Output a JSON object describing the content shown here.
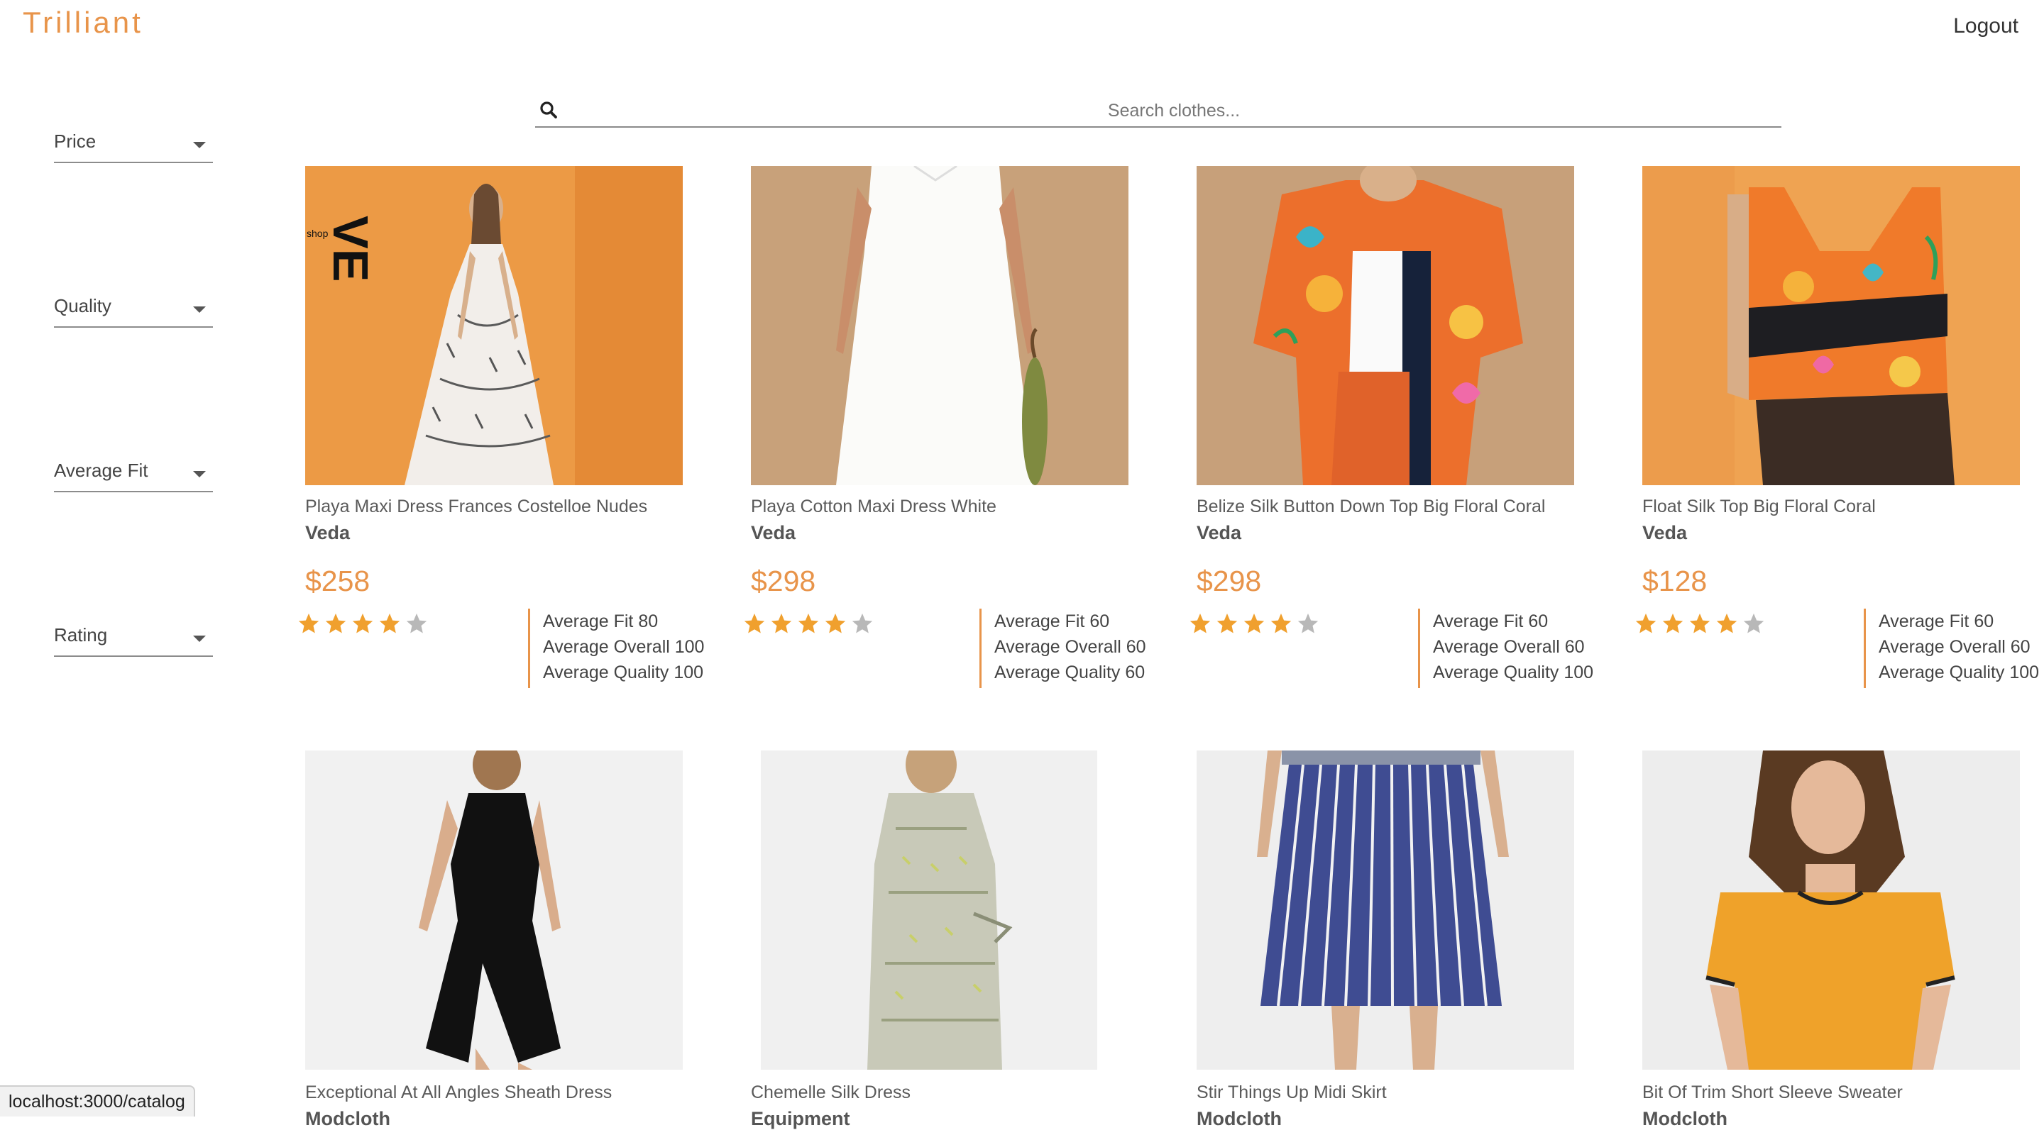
{
  "header": {
    "logo": "Trilliant",
    "logout": "Logout"
  },
  "search": {
    "placeholder": "Search clothes..."
  },
  "filters": [
    "Price",
    "Quality",
    "Average Fit",
    "Rating"
  ],
  "colors": {
    "accent": "#e8944a",
    "star_on": "#f0a02e",
    "star_off": "#b8b8b8"
  },
  "products": [
    {
      "name": "Playa Maxi Dress Frances Costelloe Nudes",
      "brand": "Veda",
      "price": "$258",
      "rating": 4,
      "fit": "Average Fit 80",
      "overall": "Average Overall 100",
      "quality": "Average Quality 100"
    },
    {
      "name": "Playa Cotton Maxi Dress White",
      "brand": "Veda",
      "price": "$298",
      "rating": 4,
      "fit": "Average Fit 60",
      "overall": "Average Overall 60",
      "quality": "Average Quality 60"
    },
    {
      "name": "Belize Silk Button Down Top Big Floral Coral",
      "brand": "Veda",
      "price": "$298",
      "rating": 4,
      "fit": "Average Fit 60",
      "overall": "Average Overall 60",
      "quality": "Average Quality 100"
    },
    {
      "name": "Float Silk Top Big Floral Coral",
      "brand": "Veda",
      "price": "$128",
      "rating": 4,
      "fit": "Average Fit 60",
      "overall": "Average Overall 60",
      "quality": "Average Quality 100"
    },
    {
      "name": "Exceptional At All Angles Sheath Dress",
      "brand": "Modcloth"
    },
    {
      "name": "Chemelle Silk Dress",
      "brand": "Equipment"
    },
    {
      "name": "Stir Things Up Midi Skirt",
      "brand": "Modcloth"
    },
    {
      "name": "Bit Of Trim Short Sleeve Sweater",
      "brand": "Modcloth"
    }
  ],
  "status_url": "localhost:3000/catalog"
}
